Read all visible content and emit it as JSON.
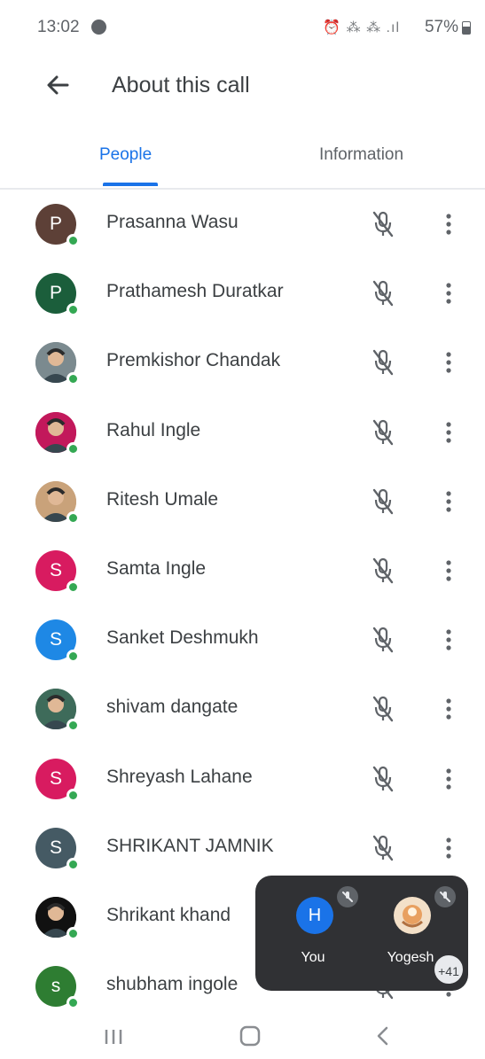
{
  "status_bar": {
    "time": "13:02",
    "icons": "⏰ ⁂ ⁂ .ıl",
    "battery": "57%"
  },
  "app_bar": {
    "title": "About this call"
  },
  "tabs": [
    {
      "label": "People",
      "active": true
    },
    {
      "label": "Information",
      "active": false
    }
  ],
  "people": [
    {
      "name": "Prasanna Wasu",
      "initial": "P",
      "avatar_color": "#5d4037",
      "photo": false,
      "muted": true
    },
    {
      "name": "Prathamesh Duratkar",
      "initial": "P",
      "avatar_color": "#1b5e3b",
      "photo": false,
      "muted": true
    },
    {
      "name": "Premkishor Chandak",
      "initial": "",
      "avatar_color": "#7b8a8f",
      "photo": true,
      "muted": true
    },
    {
      "name": "Rahul Ingle",
      "initial": "",
      "avatar_color": "#c2185b",
      "photo": true,
      "muted": true
    },
    {
      "name": "Ritesh Umale",
      "initial": "",
      "avatar_color": "#c9a27a",
      "photo": true,
      "muted": true
    },
    {
      "name": "Samta Ingle",
      "initial": "S",
      "avatar_color": "#d81b60",
      "photo": false,
      "muted": true
    },
    {
      "name": "Sanket Deshmukh",
      "initial": "S",
      "avatar_color": "#1e88e5",
      "photo": false,
      "muted": true
    },
    {
      "name": "shivam dangate",
      "initial": "",
      "avatar_color": "#3e6b5a",
      "photo": true,
      "muted": true
    },
    {
      "name": "Shreyash Lahane",
      "initial": "S",
      "avatar_color": "#d81b60",
      "photo": false,
      "muted": true
    },
    {
      "name": "SHRIKANT JAMNIK",
      "initial": "S",
      "avatar_color": "#455a64",
      "photo": false,
      "muted": true
    },
    {
      "name": "Shrikant khand",
      "initial": "",
      "avatar_color": "#111111",
      "photo": true,
      "muted": true
    },
    {
      "name": "shubham ingole",
      "initial": "s",
      "avatar_color": "#2e7d32",
      "photo": false,
      "muted": true
    }
  ],
  "pip": {
    "tiles": [
      {
        "label": "You",
        "initial": "H",
        "avatar_color": "#1a73e8"
      },
      {
        "label": "Yogesh",
        "initial": "",
        "avatar_color": "#e8a060"
      }
    ],
    "extra_count": "+41"
  },
  "colors": {
    "accent": "#1a73e8",
    "presence": "#34a853",
    "pip_background": "#303134"
  },
  "icons": {
    "back": "arrow-left-icon",
    "mic": "mic-off-icon",
    "more": "more-vert-icon",
    "nav": [
      "recents-icon",
      "home-icon",
      "back-icon"
    ]
  }
}
